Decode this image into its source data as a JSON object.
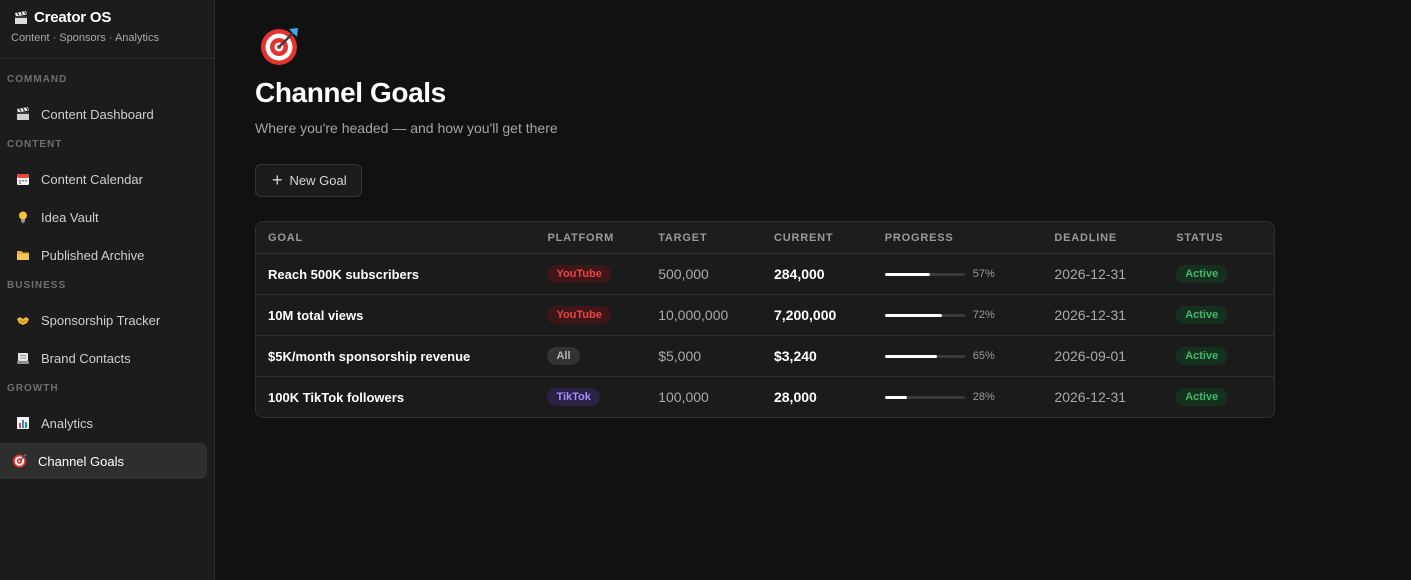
{
  "brand": {
    "title": "Creator OS",
    "subtitle": "Content · Sponsors · Analytics",
    "icon": "clapper-icon"
  },
  "sidebar": {
    "sections": [
      {
        "label": "COMMAND",
        "items": [
          {
            "label": "Content Dashboard",
            "icon": "clapper-icon"
          }
        ]
      },
      {
        "label": "CONTENT",
        "items": [
          {
            "label": "Content Calendar",
            "icon": "calendar-icon"
          },
          {
            "label": "Idea Vault",
            "icon": "lightbulb-icon"
          },
          {
            "label": "Published Archive",
            "icon": "folder-icon"
          }
        ]
      },
      {
        "label": "BUSINESS",
        "items": [
          {
            "label": "Sponsorship Tracker",
            "icon": "handshake-icon"
          },
          {
            "label": "Brand Contacts",
            "icon": "rolodex-icon"
          }
        ]
      },
      {
        "label": "GROWTH",
        "items": [
          {
            "label": "Analytics",
            "icon": "bar-chart-icon"
          },
          {
            "label": "Channel Goals",
            "icon": "target-icon",
            "active": true
          }
        ]
      }
    ]
  },
  "page": {
    "icon": "target-icon",
    "title": "Channel Goals",
    "subtitle": "Where you're headed — and how you'll get there",
    "new_button": "New Goal"
  },
  "table": {
    "headers": [
      "GOAL",
      "PLATFORM",
      "TARGET",
      "CURRENT",
      "PROGRESS",
      "DEADLINE",
      "STATUS"
    ],
    "rows": [
      {
        "goal": "Reach 500K subscribers",
        "platform": "YouTube",
        "target": "500,000",
        "current": "284,000",
        "progress": 57,
        "progress_label": "57%",
        "deadline": "2026-12-31",
        "status": "Active"
      },
      {
        "goal": "10M total views",
        "platform": "YouTube",
        "target": "10,000,000",
        "current": "7,200,000",
        "progress": 72,
        "progress_label": "72%",
        "deadline": "2026-12-31",
        "status": "Active"
      },
      {
        "goal": "$5K/month sponsorship revenue",
        "platform": "All",
        "target": "$5,000",
        "current": "$3,240",
        "progress": 65,
        "progress_label": "65%",
        "deadline": "2026-09-01",
        "status": "Active"
      },
      {
        "goal": "100K TikTok followers",
        "platform": "TikTok",
        "target": "100,000",
        "current": "28,000",
        "progress": 28,
        "progress_label": "28%",
        "deadline": "2026-12-31",
        "status": "Active"
      }
    ]
  },
  "colors": {
    "youtube_text": "#ef4444",
    "youtube_bg": "#3d1717",
    "all_text": "#b5b5b5",
    "all_bg": "#333333",
    "tiktok_text": "#a78bfa",
    "tiktok_bg": "#2b2142",
    "status_active": "#3fb968"
  }
}
